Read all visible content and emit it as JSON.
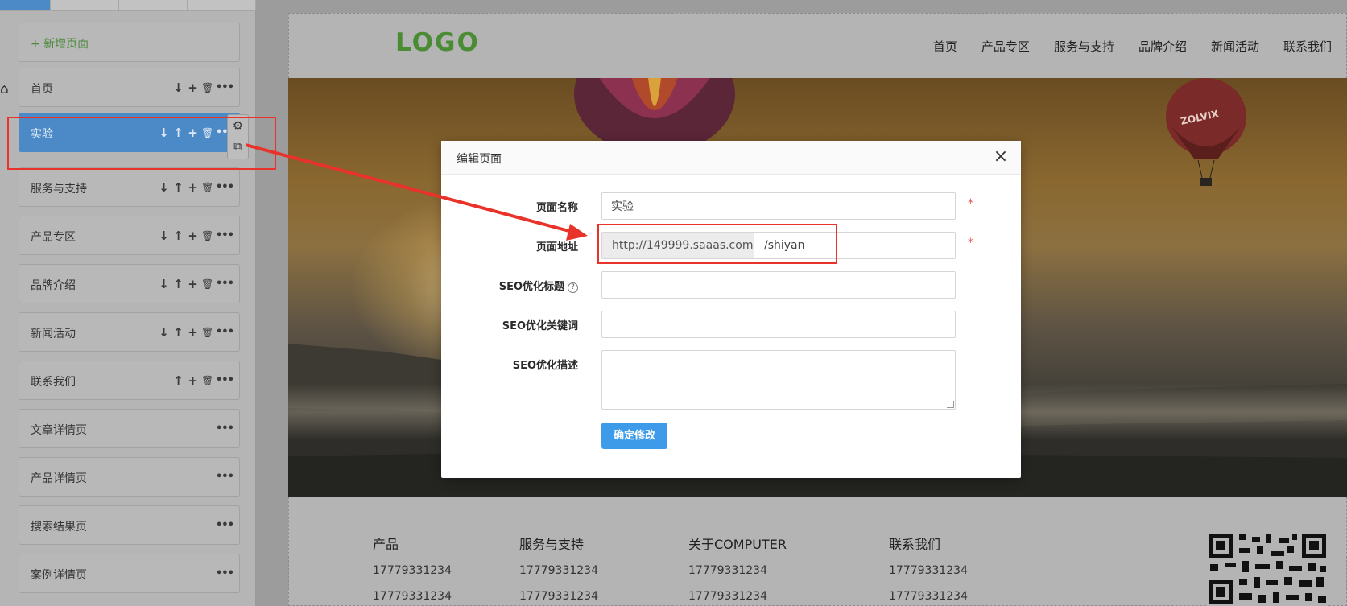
{
  "sidebar": {
    "add_page_label": "+ 新增页面",
    "pages": [
      {
        "label": "首页",
        "home": true,
        "actions": [
          "down",
          "add",
          "delete",
          "more"
        ]
      },
      {
        "label": "实验",
        "active": true,
        "actions": [
          "down",
          "up",
          "add",
          "delete",
          "more"
        ]
      },
      {
        "label": "服务与支持",
        "actions": [
          "down",
          "up",
          "add",
          "delete",
          "more"
        ]
      },
      {
        "label": "产品专区",
        "actions": [
          "down",
          "up",
          "add",
          "delete",
          "more"
        ]
      },
      {
        "label": "品牌介绍",
        "actions": [
          "down",
          "up",
          "add",
          "delete",
          "more"
        ]
      },
      {
        "label": "新闻活动",
        "actions": [
          "down",
          "up",
          "add",
          "delete",
          "more"
        ]
      },
      {
        "label": "联系我们",
        "actions": [
          "up",
          "add",
          "delete",
          "more"
        ]
      },
      {
        "label": "文章详情页",
        "actions": [
          "more"
        ]
      },
      {
        "label": "产品详情页",
        "actions": [
          "more"
        ]
      },
      {
        "label": "搜索结果页",
        "actions": [
          "more"
        ]
      },
      {
        "label": "案例详情页",
        "actions": [
          "more"
        ]
      }
    ],
    "float_tools": [
      "gear-icon",
      "copy-icon"
    ]
  },
  "preview": {
    "logo": "LOGO",
    "nav": [
      "首页",
      "产品专区",
      "服务与支持",
      "品牌介绍",
      "新闻活动",
      "联系我们"
    ],
    "balloon_text": "ZOLVIX",
    "footer": [
      {
        "heading": "产品",
        "values": [
          "17779331234",
          "17779331234"
        ]
      },
      {
        "heading": "服务与支持",
        "values": [
          "17779331234",
          "17779331234"
        ]
      },
      {
        "heading": "关于COMPUTER",
        "values": [
          "17779331234",
          "17779331234"
        ]
      },
      {
        "heading": "联系我们",
        "values": [
          "17779331234",
          "17779331234"
        ]
      }
    ]
  },
  "modal": {
    "title": "编辑页面",
    "close_icon": "close-icon",
    "fields": {
      "name_label": "页面名称",
      "name_value": "实验",
      "url_label": "页面地址",
      "url_prefix": "http://149999.saaas.com",
      "url_value": "/shiyan",
      "seo_title_label": "SEO优化标题",
      "seo_title_help": "?",
      "seo_title_value": "",
      "seo_keywords_label": "SEO优化关键词",
      "seo_keywords_value": "",
      "seo_desc_label": "SEO优化描述",
      "seo_desc_value": "",
      "required_mark": "*"
    },
    "confirm_label": "确定修改"
  },
  "colors": {
    "accent": "#3d9be9",
    "sidebar_active": "#4b8ac7",
    "logo": "#4a8c33",
    "annotation": "#e8322a",
    "required": "#e84f4f"
  }
}
